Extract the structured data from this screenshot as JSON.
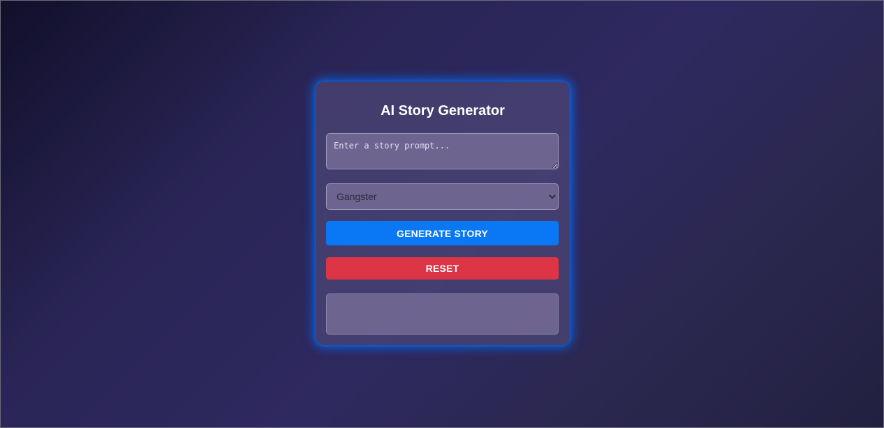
{
  "app": {
    "title": "AI Story Generator"
  },
  "prompt": {
    "value": "",
    "placeholder": "Enter a story prompt..."
  },
  "genre": {
    "selected": "Gangster",
    "options": [
      "Gangster"
    ]
  },
  "buttons": {
    "generate_label": "GENERATE STORY",
    "reset_label": "RESET"
  },
  "output": {
    "text": ""
  },
  "colors": {
    "generate": "#0a78f5",
    "reset": "#dc3545",
    "glow": "#006eff"
  }
}
